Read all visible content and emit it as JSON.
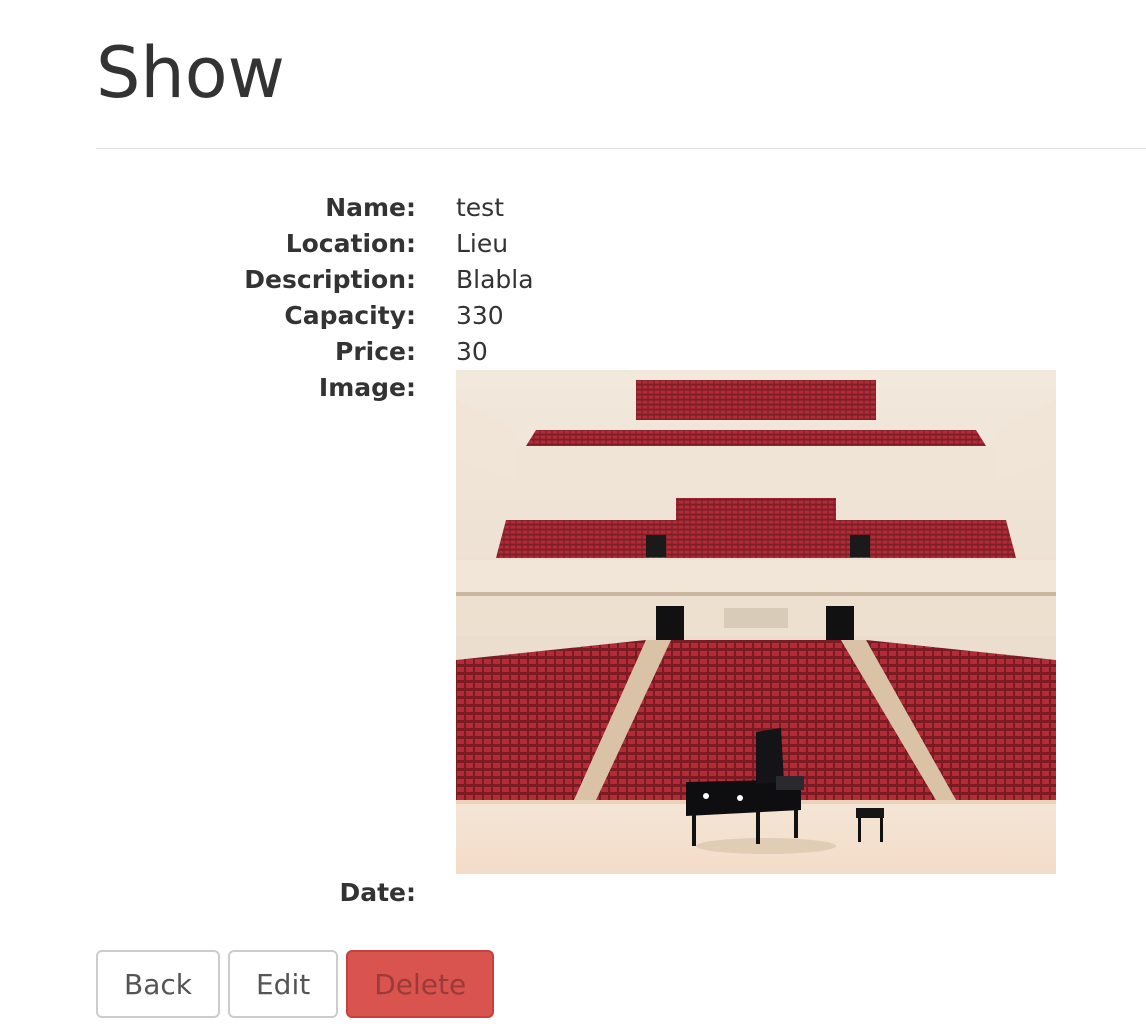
{
  "page": {
    "title": "Show"
  },
  "details": {
    "name": {
      "label": "Name:",
      "value": "test"
    },
    "location": {
      "label": "Location:",
      "value": "Lieu"
    },
    "description": {
      "label": "Description:",
      "value": "Blabla"
    },
    "capacity": {
      "label": "Capacity:",
      "value": "330"
    },
    "price": {
      "label": "Price:",
      "value": "30"
    },
    "image": {
      "label": "Image:",
      "alt": "Concert hall with grand piano on stage"
    },
    "date": {
      "label": "Date:",
      "value": ""
    }
  },
  "actions": {
    "back_label": "Back",
    "edit_label": "Edit",
    "delete_label": "Delete"
  },
  "colors": {
    "text": "#333333",
    "delete_button": "#d9534f",
    "border": "#cccccc"
  }
}
